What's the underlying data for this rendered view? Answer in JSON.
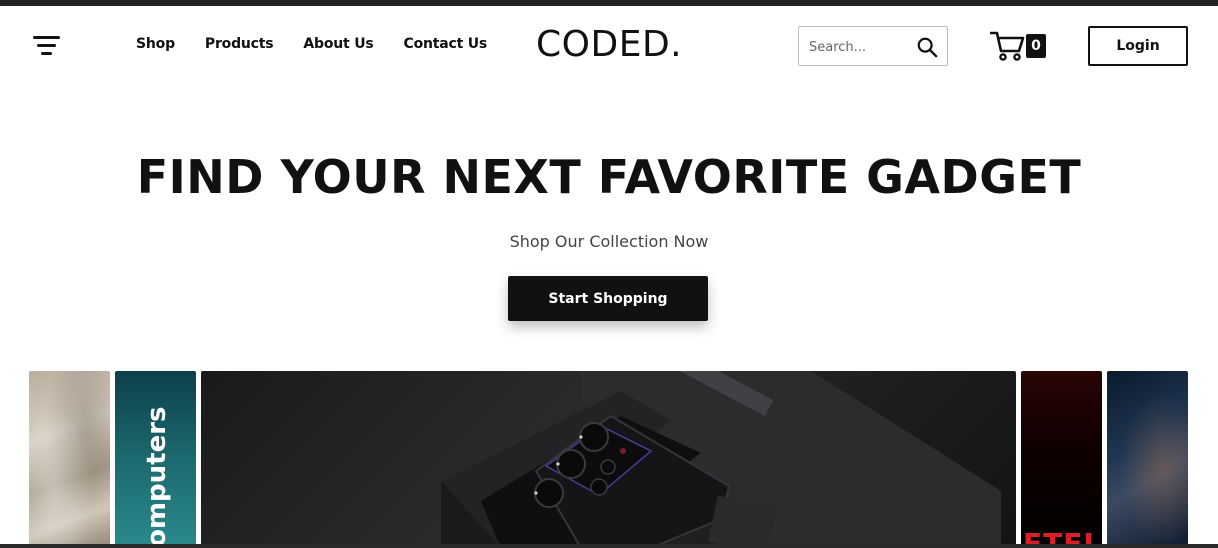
{
  "brand": {
    "logo": "CODED."
  },
  "nav": {
    "menu_icon": "hamburger-menu-icon",
    "links": [
      "Shop",
      "Products",
      "About Us",
      "Contact Us"
    ]
  },
  "search": {
    "placeholder": "Search...",
    "icon": "search-icon"
  },
  "cart": {
    "icon": "cart-icon",
    "count": "0"
  },
  "login": {
    "label": "Login"
  },
  "hero": {
    "title": "FIND YOUR NEXT FAVORITE GADGET",
    "subtitle": "Shop Our Collection Now",
    "cta_label": "Start Shopping"
  },
  "gallery": {
    "panels": [
      {
        "name": "panel-1",
        "label": ""
      },
      {
        "name": "panel-computers",
        "label": "Computers"
      },
      {
        "name": "panel-phone",
        "label": ""
      },
      {
        "name": "panel-netflix",
        "label": "ETFLI"
      },
      {
        "name": "panel-5",
        "label": ""
      }
    ]
  },
  "colors": {
    "primary": "#111111",
    "text": "#111111",
    "muted": "#444444",
    "background": "#ffffff",
    "border": "#bfbfbf",
    "netflix_red": "#d81f26"
  }
}
